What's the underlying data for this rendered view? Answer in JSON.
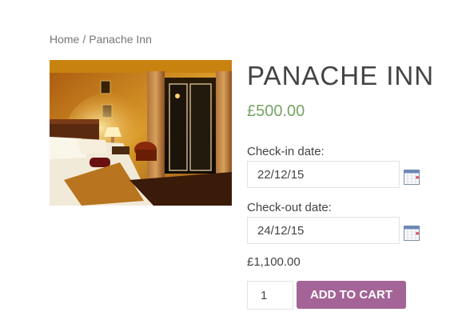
{
  "breadcrumb": {
    "home": "Home",
    "separator": "/",
    "current": "Panache Inn"
  },
  "product": {
    "title": "PANACHE INN",
    "price": "£500.00",
    "image_alt": "Hotel bedroom"
  },
  "booking": {
    "checkin_label": "Check-in date:",
    "checkin_value": "22/12/15",
    "checkout_label": "Check-out date:",
    "checkout_value": "24/12/15",
    "calendar_icon": "calendar-icon",
    "total": "£1,100.00"
  },
  "cart": {
    "quantity": "1",
    "add_label": "ADD TO CART"
  },
  "colors": {
    "price": "#77a464",
    "button": "#a46497",
    "button_text": "#ffffff"
  }
}
